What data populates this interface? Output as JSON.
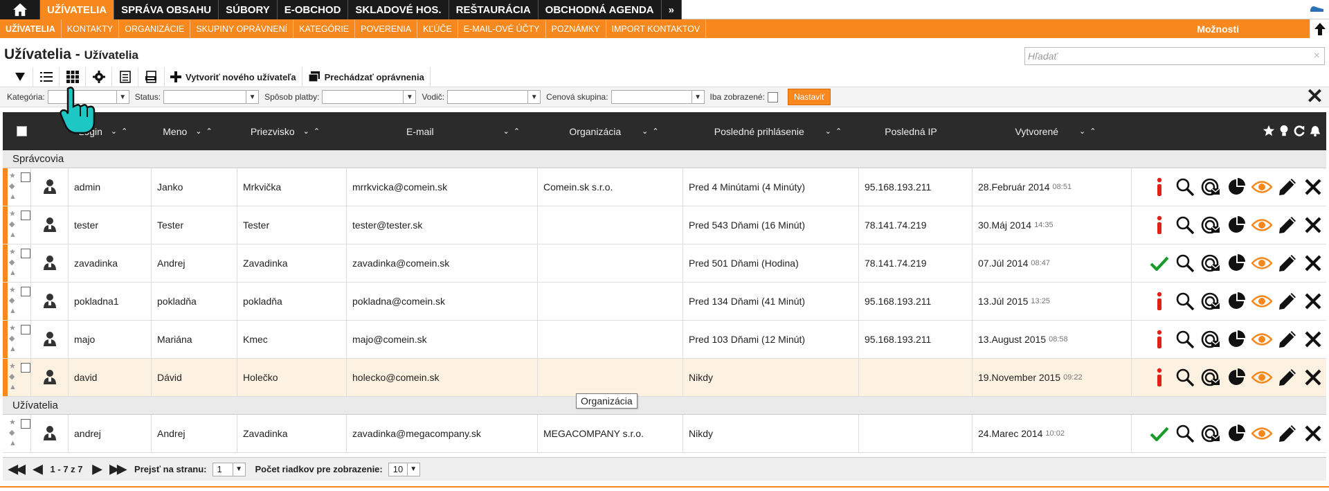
{
  "topnav": {
    "items": [
      "UŽÍVATELIA",
      "SPRÁVA OBSAHU",
      "SÚBORY",
      "E-OBCHOD",
      "SKLADOVÉ HOS.",
      "REŠTAURÁCIA",
      "OBCHODNÁ AGENDA",
      "»"
    ],
    "active_index": 0
  },
  "subnav": {
    "items": [
      "UŽÍVATELIA",
      "KONTAKTY",
      "ORGANIZÁCIE",
      "SKUPINY OPRÁVNENÍ",
      "KATEGÓRIE",
      "POVERENIA",
      "KĽÚČE",
      "E-MAIL-OVÉ ÚČTY",
      "POZNÁMKY",
      "IMPORT KONTAKTOV"
    ],
    "options_label": "Možnosti"
  },
  "header": {
    "title": "Užívatelia -",
    "subtitle": "Užívatelia",
    "search_placeholder": "Hľadať"
  },
  "toolbar": {
    "create_label": "Vytvoriť nového užívateľa",
    "permissions_label": "Prechádzať oprávnenia"
  },
  "filters": {
    "category_label": "Kategória:",
    "status_label": "Status:",
    "payment_label": "Spôsob platby:",
    "driver_label": "Vodič:",
    "price_group_label": "Cenová skupina:",
    "only_shown_label": "Iba zobrazené:",
    "apply_label": "Nastaviť"
  },
  "table": {
    "columns": [
      "Login",
      "Meno",
      "Priezvisko",
      "E-mail",
      "Organizácia",
      "Posledné prihlásenie",
      "Posledná IP",
      "Vytvorené"
    ],
    "groups": [
      {
        "name": "Správcovia",
        "rows": [
          {
            "login": "admin",
            "meno": "Janko",
            "priezvisko": "Mrkvička",
            "email": "mrrkvicka@comein.sk",
            "org": "Comein.sk s.r.o.",
            "last_login": "Pred 4 Minútami (4 Minúty)",
            "ip": "95.168.193.211",
            "created": "28.Február 2014",
            "created_time": "08:51",
            "status": "info"
          },
          {
            "login": "tester",
            "meno": "Tester",
            "priezvisko": "Tester",
            "email": "tester@tester.sk",
            "org": "",
            "last_login": "Pred 543 Dňami (16 Minút)",
            "ip": "78.141.74.219",
            "created": "30.Máj 2014",
            "created_time": "14:35",
            "status": "info"
          },
          {
            "login": "zavadinka",
            "meno": "Andrej",
            "priezvisko": "Zavadinka",
            "email": "zavadinka@comein.sk",
            "org": "",
            "last_login": "Pred 501 Dňami (Hodina)",
            "ip": "78.141.74.219",
            "created": "07.Júl 2014",
            "created_time": "08:47",
            "status": "ok"
          },
          {
            "login": "pokladna1",
            "meno": "pokladňa",
            "priezvisko": "pokladňa",
            "email": "pokladna@comein.sk",
            "org": "",
            "last_login": "Pred 134 Dňami (41 Minút)",
            "ip": "95.168.193.211",
            "created": "13.Júl 2015",
            "created_time": "13:25",
            "status": "info"
          },
          {
            "login": "majo",
            "meno": "Mariána",
            "priezvisko": "Kmec",
            "email": "majo@comein.sk",
            "org": "",
            "last_login": "Pred 103 Dňami (12 Minút)",
            "ip": "95.168.193.211",
            "created": "13.August 2015",
            "created_time": "08:58",
            "status": "info"
          },
          {
            "login": "david",
            "meno": "Dávid",
            "priezvisko": "Holečko",
            "email": "holecko@comein.sk",
            "org": "",
            "last_login": "Nikdy",
            "ip": "",
            "created": "19.November 2015",
            "created_time": "09:22",
            "status": "info"
          }
        ]
      },
      {
        "name": "Užívatelia",
        "rows": [
          {
            "login": "andrej",
            "meno": "Andrej",
            "priezvisko": "Zavadinka",
            "email": "zavadinka@megacompany.sk",
            "org": "MEGACOMPANY s.r.o.",
            "last_login": "Nikdy",
            "ip": "",
            "created": "24.Marec 2014",
            "created_time": "10:02",
            "status": "ok"
          }
        ]
      }
    ],
    "tooltip": "Organizácia"
  },
  "pager": {
    "range": "1 - 7 z 7",
    "goto_label": "Prejsť na stranu:",
    "page_value": "1",
    "rows_label": "Počet riadkov pre zobrazenie:",
    "rows_value": "10"
  },
  "colors": {
    "accent": "#f7881e",
    "header_dark": "#2b2b2b",
    "ok_green": "#1a9a2a",
    "info_red": "#e0201b"
  }
}
